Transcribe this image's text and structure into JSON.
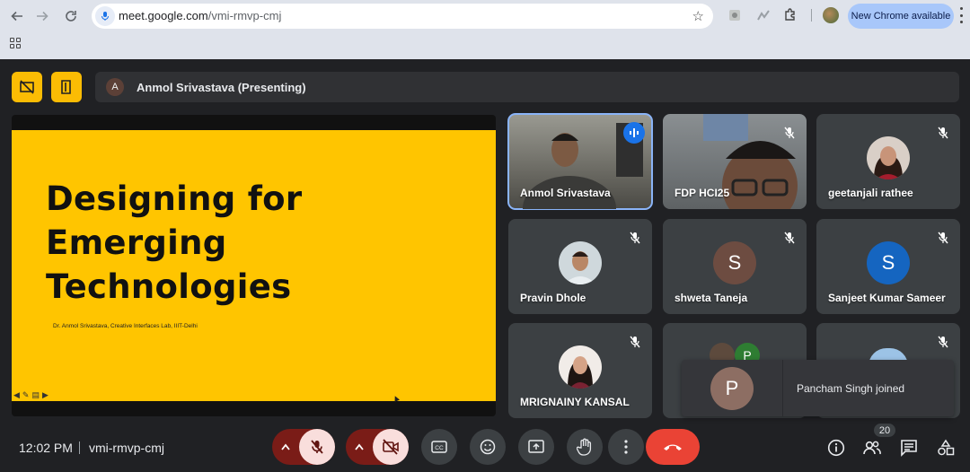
{
  "browser": {
    "url_host": "meet.google.com",
    "url_path": "/vmi-rmvp-cmj",
    "update_label": "New Chrome available"
  },
  "meet": {
    "presenter_initial": "A",
    "presenting_label": "Anmol Srivastava (Presenting)",
    "slide": {
      "title_line1": "Designing for",
      "title_line2": "Emerging",
      "title_line3": "Technologies",
      "byline": "Dr. Anmol Srivastava, Creative Interfaces Lab, IIIT-Delhi",
      "background_color": "#ffc500"
    },
    "participants": [
      {
        "name": "Anmol Srivastava",
        "type": "video",
        "speaking": true
      },
      {
        "name": "FDP HCI25",
        "type": "video",
        "muted": true
      },
      {
        "name": "geetanjali rathee",
        "type": "photo",
        "muted": true
      },
      {
        "name": "Pravin Dhole",
        "type": "photo",
        "muted": true
      },
      {
        "name": "shweta Taneja",
        "type": "letter",
        "initial": "S",
        "color": "#6d4c41",
        "muted": true
      },
      {
        "name": "Sanjeet Kumar Sameer",
        "type": "letter",
        "initial": "S",
        "color": "#1565c0",
        "muted": true
      },
      {
        "name": "MRIGNAINY KANSAL",
        "type": "photo",
        "muted": true
      },
      {
        "name": "",
        "type": "group",
        "initial": "P",
        "muted": false
      },
      {
        "name": "",
        "type": "photo",
        "muted": true
      }
    ],
    "toast": {
      "initial": "P",
      "message": "Pancham Singh joined"
    },
    "bottom": {
      "time": "12:02 PM",
      "meeting_code": "vmi-rmvp-cmj",
      "people_count": "20"
    },
    "colors": {
      "accent_red": "#ea4335",
      "off_red": "#f9dedc",
      "speaking_blue": "#1a73e8",
      "warning_yellow": "#fbbc04"
    }
  }
}
